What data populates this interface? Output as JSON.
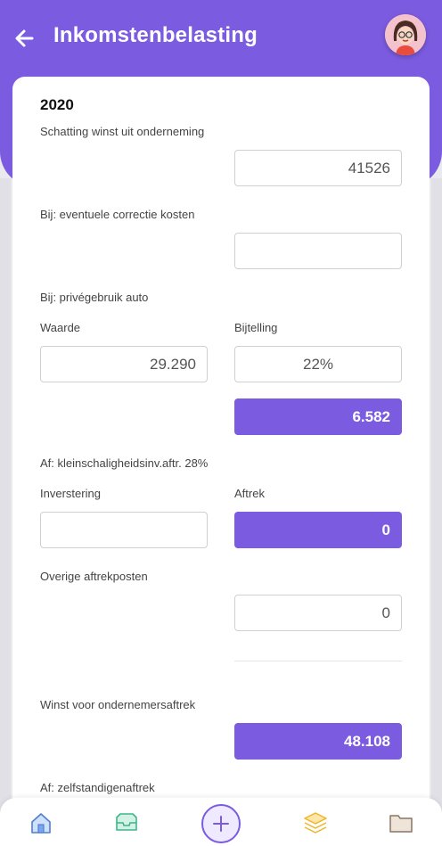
{
  "header": {
    "title": "Inkomstenbelasting"
  },
  "form": {
    "year": "2020",
    "profit_label": "Schatting winst uit onderneming",
    "profit_value": "41526",
    "correction_label": "Bij: eventuele correctie kosten",
    "correction_value": "",
    "car_label": "Bij: privégebruik auto",
    "car_value_label": "Waarde",
    "car_value": "29.290",
    "car_addition_label": "Bijtelling",
    "car_addition_value": "22%",
    "car_addition_result": "6.582",
    "ksi_label": "Af: kleinschaligheidsinv.aftr. 28%",
    "investment_label": "Inverstering",
    "investment_value": "",
    "deduction_label": "Aftrek",
    "deduction_value": "0",
    "other_label": "Overige aftrekposten",
    "other_value": "0",
    "pre_entrepreneur_label": "Winst voor ondernemersaftrek",
    "pre_entrepreneur_value": "48.108",
    "self_employed_label": "Af: zelfstandigenaftrek"
  },
  "nav": {
    "items": [
      "home-icon",
      "inbox-icon",
      "add-icon",
      "layers-icon",
      "folder-icon"
    ]
  },
  "colors": {
    "accent": "#7b5ce0"
  }
}
